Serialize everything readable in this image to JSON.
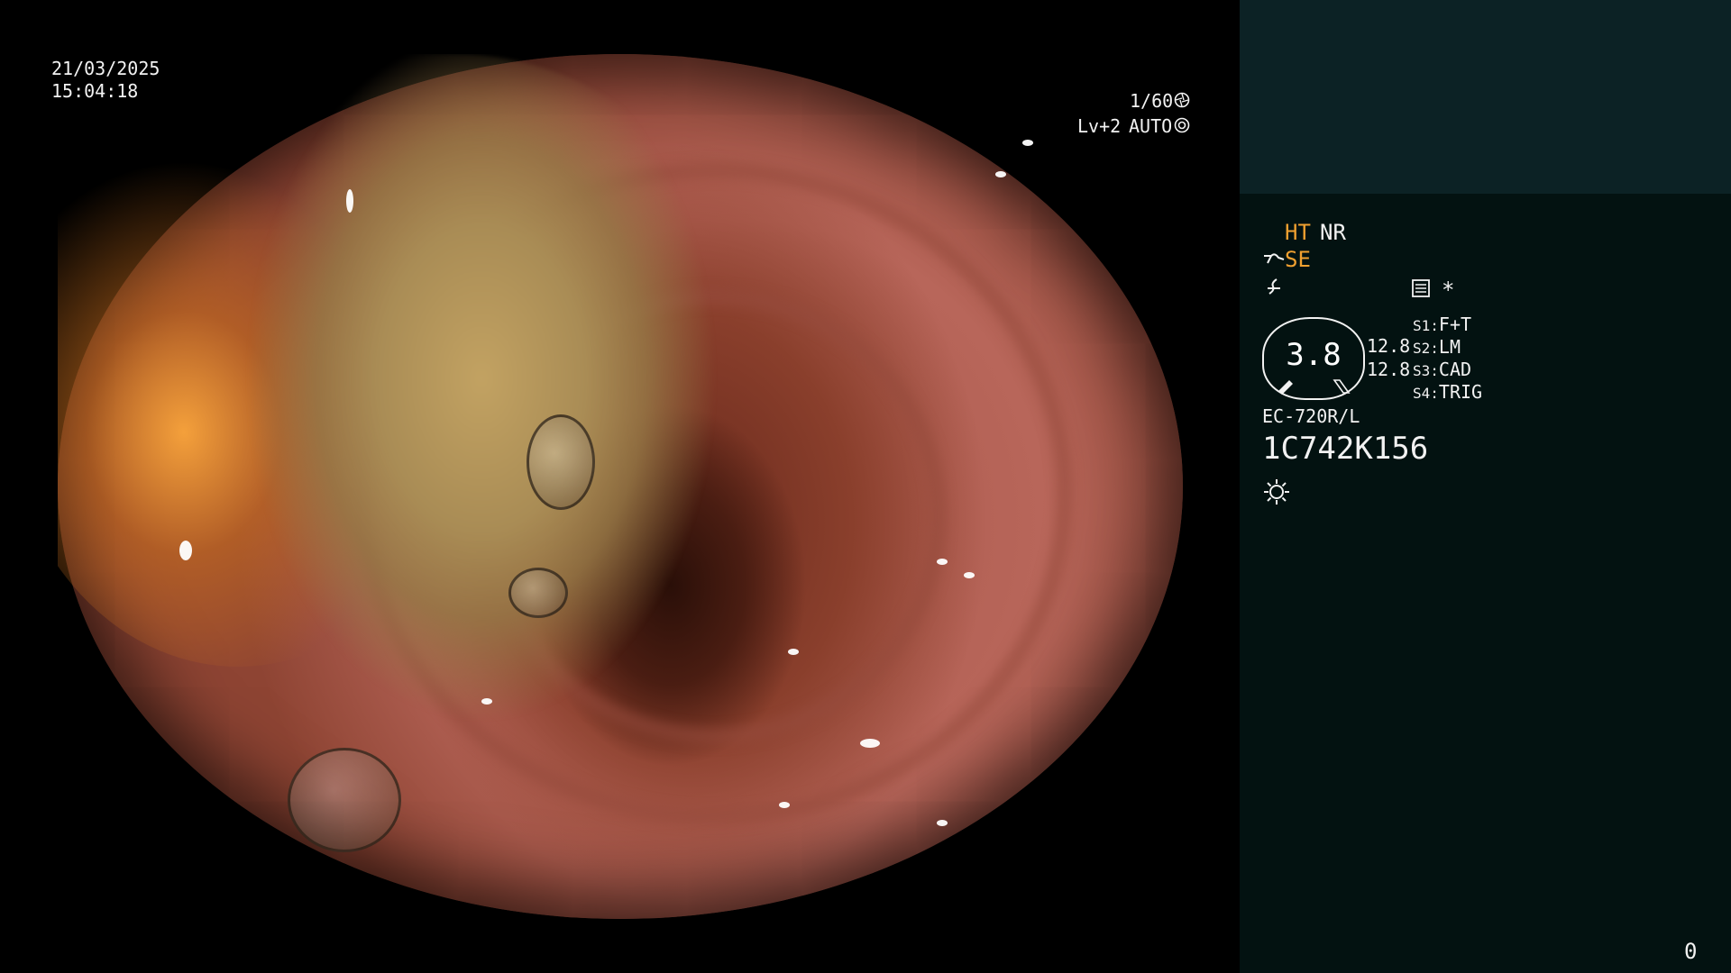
{
  "overlay": {
    "date": "21/03/2025",
    "time": "15:04:18",
    "shutter": "1/60",
    "level": "Lv+2",
    "mode": "AUTO"
  },
  "panel": {
    "ht": "HT",
    "nr": "NR",
    "se": "SE",
    "asterisk": "*",
    "gauge_value": "3.8",
    "scale_top": "12.8",
    "scale_bottom": "12.8",
    "switches": [
      {
        "key": "S1:",
        "value": "F+T"
      },
      {
        "key": "S2:",
        "value": "LM"
      },
      {
        "key": "S3:",
        "value": "CAD"
      },
      {
        "key": "S4:",
        "value": "TRIG"
      }
    ],
    "scope_model": "EC-720R/L",
    "serial": "1C742K156",
    "counter": "0"
  },
  "colors": {
    "panel_bg": "#031211",
    "panel_top_bg": "#0c2225",
    "highlight": "#f0a030"
  }
}
